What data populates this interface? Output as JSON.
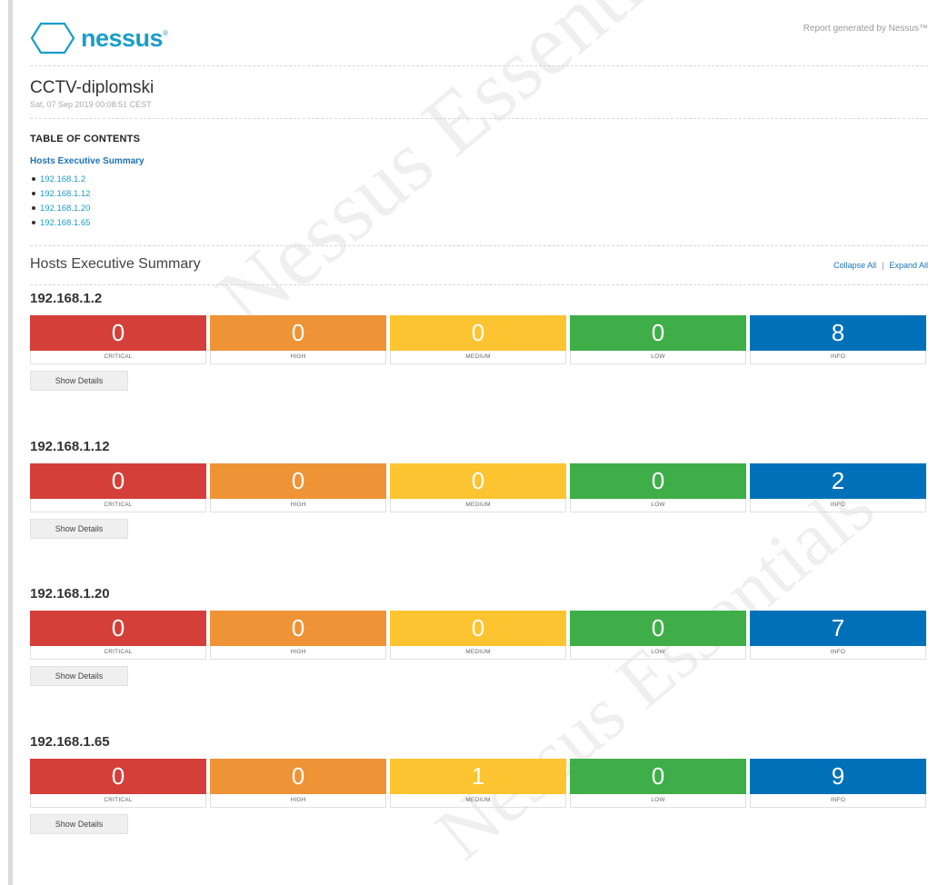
{
  "header": {
    "logo_text": "nessus",
    "logo_tm": "®",
    "generated_text": "Report generated by Nessus™"
  },
  "report": {
    "title": "CCTV-diplomski",
    "date": "Sat, 07 Sep 2019 00:08:51 CEST"
  },
  "toc": {
    "heading": "TABLE OF CONTENTS",
    "main_link": "Hosts Executive Summary",
    "items": [
      "192.168.1.2",
      "192.168.1.12",
      "192.168.1.20",
      "192.168.1.65"
    ]
  },
  "summary": {
    "title": "Hosts Executive Summary",
    "collapse_all": "Collapse All",
    "separator": "|",
    "expand_all": "Expand All"
  },
  "severity_labels": [
    "CRITICAL",
    "HIGH",
    "MEDIUM",
    "LOW",
    "INFO"
  ],
  "severity_colors": [
    "#d43f3a",
    "#ee9336",
    "#fdc431",
    "#3fae49",
    "#0071b9"
  ],
  "show_details_label": "Show Details",
  "hosts": [
    {
      "ip": "192.168.1.2",
      "counts": [
        "0",
        "0",
        "0",
        "0",
        "8"
      ]
    },
    {
      "ip": "192.168.1.12",
      "counts": [
        "0",
        "0",
        "0",
        "0",
        "2"
      ]
    },
    {
      "ip": "192.168.1.20",
      "counts": [
        "0",
        "0",
        "0",
        "0",
        "7"
      ]
    },
    {
      "ip": "192.168.1.65",
      "counts": [
        "0",
        "0",
        "1",
        "0",
        "9"
      ]
    }
  ],
  "watermark": "Nessus Essentials"
}
